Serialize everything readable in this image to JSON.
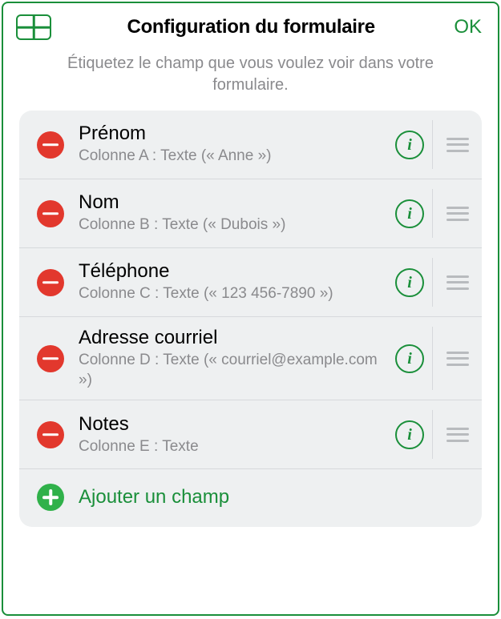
{
  "header": {
    "title": "Configuration du formulaire",
    "ok_label": "OK"
  },
  "subtitle": "Étiquetez le champ que vous voulez voir dans votre formulaire.",
  "fields": [
    {
      "title": "Prénom",
      "subtitle": "Colonne A : Texte (« Anne »)"
    },
    {
      "title": "Nom",
      "subtitle": "Colonne B : Texte (« Dubois »)"
    },
    {
      "title": "Téléphone",
      "subtitle": "Colonne C : Texte (« 123 456-7890 »)"
    },
    {
      "title": "Adresse courriel",
      "subtitle": "Colonne D : Texte (« courriel@example.com »)"
    },
    {
      "title": "Notes",
      "subtitle": "Colonne E : Texte"
    }
  ],
  "add_label": "Ajouter un champ",
  "info_glyph": "i"
}
